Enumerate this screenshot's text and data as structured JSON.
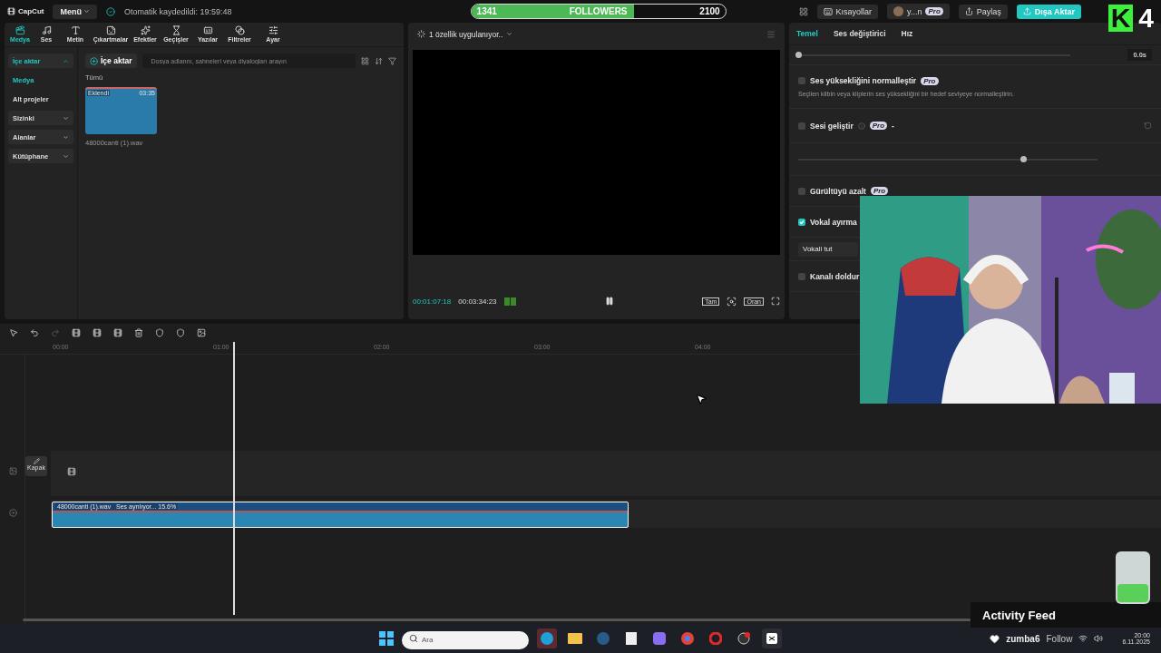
{
  "app": {
    "logo": "CapCut",
    "menu": "Menü",
    "autosave": "Otomatik kaydedildi: 19:59:48",
    "shortcuts": "Kısayollar",
    "user": "y...n",
    "user_badge": "Pro",
    "share": "Paylaş",
    "export": "Dışa Aktar"
  },
  "followers_goal": {
    "current": "1341",
    "label": "FOLLOWERS",
    "target": "2100",
    "level": 0.64
  },
  "channel_logo": {
    "letter": "K",
    "number": "4"
  },
  "tool_tabs": [
    {
      "label": "Medya",
      "selected": true
    },
    {
      "label": "Ses",
      "selected": false
    },
    {
      "label": "Metin",
      "selected": false
    },
    {
      "label": "Çıkartmalar",
      "selected": false
    },
    {
      "label": "Efektler",
      "selected": false
    },
    {
      "label": "Geçişler",
      "selected": false
    },
    {
      "label": "Yazılar",
      "selected": false
    },
    {
      "label": "Filtreler",
      "selected": false
    },
    {
      "label": "Ayar",
      "selected": false
    }
  ],
  "media_sidebar": [
    {
      "label": "İçe aktar",
      "kind": "group",
      "expanded": true,
      "selected": true
    },
    {
      "label": "Medya",
      "kind": "link",
      "selected": true
    },
    {
      "label": "Alt projeler",
      "kind": "link",
      "selected": false
    },
    {
      "label": "Sizinki",
      "kind": "group",
      "expanded": false,
      "selected": false
    },
    {
      "label": "Alanlar",
      "kind": "group",
      "expanded": false,
      "selected": false
    },
    {
      "label": "Kütüphane",
      "kind": "group",
      "expanded": false,
      "selected": false
    }
  ],
  "media": {
    "import_button": "İçe aktar",
    "search_placeholder": "Dosya adlarını, sahneleri veya diyalogları arayın",
    "filter": "Tümü",
    "items": [
      {
        "name": "48000canti (1).wav",
        "badge": "Eklendi",
        "duration": "03:35"
      }
    ]
  },
  "player": {
    "status": "1 özellik uygulanıyor..",
    "current_time": "00:01:07:18",
    "total_time": "00:03:34:23",
    "buttons": [
      "Tam",
      "Oran"
    ]
  },
  "properties": {
    "tabs": [
      {
        "label": "Temel",
        "selected": true
      },
      {
        "label": "Ses değiştirici",
        "selected": false
      },
      {
        "label": "Hız",
        "selected": false
      }
    ],
    "time_value": "0.0s",
    "options": [
      {
        "kind": "check",
        "label": "Ses yüksekliğini normalleştir",
        "pro": "Pro",
        "checked": false,
        "description": "Seçilen klibin veya kliplerin ses yüksekliğini bir hedef seviyeye normalleştirin."
      },
      {
        "kind": "check",
        "label": "Sesi geliştir",
        "pro": "Pro",
        "checked": false,
        "suffix": "-"
      },
      {
        "kind": "slider",
        "level": 0.75
      },
      {
        "kind": "check",
        "label": "Gürültüyü azalt",
        "pro": "Pro",
        "checked": false
      },
      {
        "kind": "check",
        "label": "Vokal ayırma",
        "checked": true
      },
      {
        "kind": "select",
        "value": "Vokali tut"
      },
      {
        "kind": "check",
        "label": "Kanalı doldur",
        "checked": false
      }
    ]
  },
  "timeline": {
    "ruler": [
      "00:00",
      "01:00",
      "02:00",
      "03:00",
      "04:00"
    ],
    "cover_button": "Kapak",
    "clip": {
      "name": "48000canti (1).wav",
      "status": "Ses ayrılıyor... 15.6%"
    }
  },
  "activity_feed": {
    "title": "Activity Feed",
    "user": "zumba6",
    "action": "Follow"
  },
  "taskbar": {
    "search_placeholder": "Ara",
    "time": "20:00",
    "date": "6.11.2025"
  }
}
